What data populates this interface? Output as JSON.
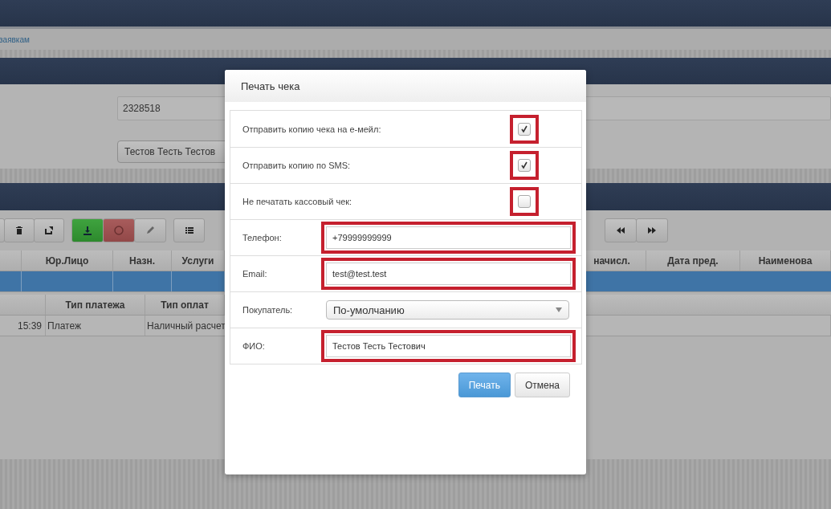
{
  "breadcrumb": {
    "link": "заявкам"
  },
  "form": {
    "number": "2328518",
    "client": "Тестов Тесть Тестов"
  },
  "table": {
    "columns_left": [
      "Юр.Лицо",
      "Назн.",
      "Услуги"
    ],
    "columns_right": [
      "начисл.",
      "Дата пред.",
      "Наименова"
    ],
    "selected_row": {
      "selected": true
    }
  },
  "payments": {
    "columns": [
      "",
      "Тип платежа",
      "Тип оплат"
    ],
    "rows": [
      [
        "15:39",
        "Платеж",
        "Наличный расчет"
      ]
    ]
  },
  "dialog": {
    "title": "Печать чека",
    "rows": [
      {
        "kind": "checkbox",
        "label": "Отправить копию чека на е-мейл:",
        "checked": true,
        "highlighted": true
      },
      {
        "kind": "checkbox",
        "label": "Отправить копию по SMS:",
        "checked": true,
        "highlighted": true
      },
      {
        "kind": "checkbox",
        "label": "Не печатать кассовый чек:",
        "checked": false,
        "highlighted": true
      },
      {
        "kind": "input",
        "label": "Телефон:",
        "value": "+79999999999",
        "highlighted": true
      },
      {
        "kind": "input",
        "label": "Email:",
        "value": "test@test.test",
        "highlighted": true
      },
      {
        "kind": "select",
        "label": "Покупатель:",
        "value": "По-умолчанию",
        "highlighted": false
      },
      {
        "kind": "input",
        "label": "ФИО:",
        "value": "Тестов Тесть Тестович",
        "highlighted": true
      }
    ],
    "buttons": [
      {
        "label": "Печать",
        "kind": "primary"
      },
      {
        "label": "Отмена",
        "kind": "default"
      }
    ]
  }
}
